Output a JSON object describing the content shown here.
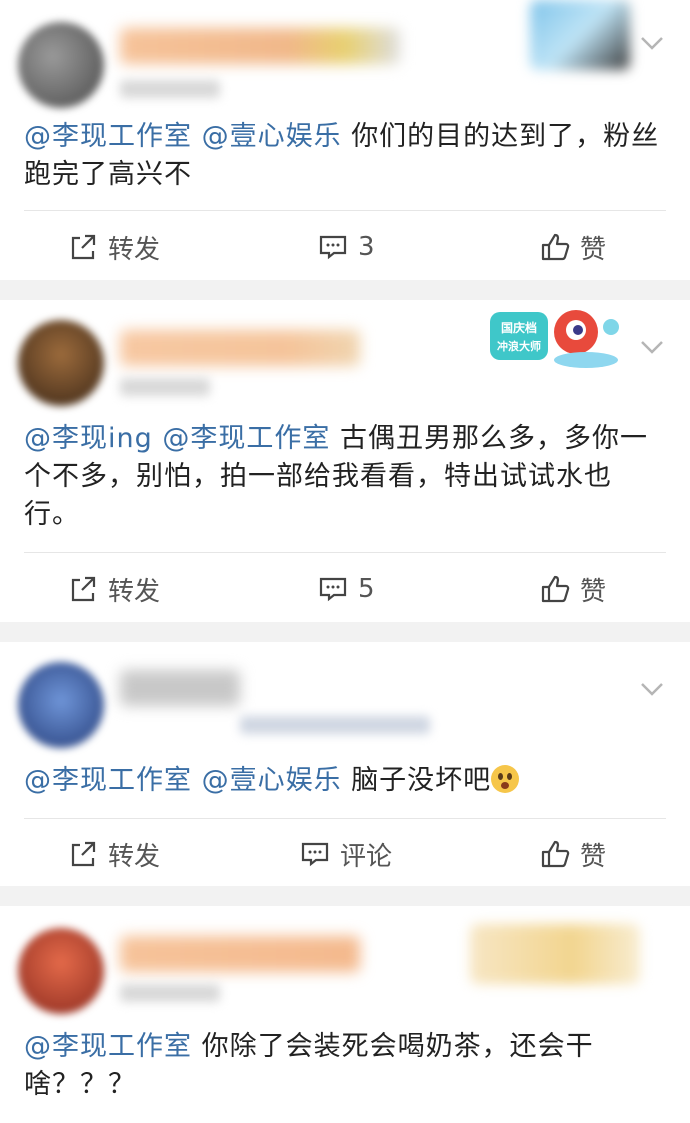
{
  "posts": [
    {
      "text_mentions": [
        "@李现工作室",
        "@壹心娱乐"
      ],
      "text_body": "你们的目的达到了，粉丝跑完了高兴不",
      "repost_label": "转发",
      "comment_label": "3",
      "like_label": "赞",
      "avatar_color": "#6e6e6e",
      "name_color": "#f1b88a"
    },
    {
      "text_mentions": [
        "@李现ing",
        "@李现工作室"
      ],
      "text_body": "古偶丑男那么多，多你一个不多，别怕，拍一部给我看看，特出试试水也行。",
      "repost_label": "转发",
      "comment_label": "5",
      "like_label": "赞",
      "badge_text_line1": "国庆档",
      "badge_text_line2": "冲浪大师",
      "avatar_color": "#6b4a2a",
      "name_color": "#f5c49a"
    },
    {
      "text_mentions": [
        "@李现工作室",
        "@壹心娱乐"
      ],
      "text_body": "脑子没坏吧",
      "emoji": "surprised-face",
      "repost_label": "转发",
      "comment_label": "评论",
      "like_label": "赞",
      "avatar_color": "#3c64b4",
      "name_color": "#b8b8b8"
    },
    {
      "text_mentions": [
        "@李现工作室"
      ],
      "text_body": "你除了会装死会喝奶茶，还会干啥？？？",
      "avatar_color": "#c8442e",
      "name_color": "#f4b98d"
    }
  ],
  "colors": {
    "mention": "#3a6ea5",
    "separator": "#f2f2f2",
    "action_text": "#555555"
  }
}
